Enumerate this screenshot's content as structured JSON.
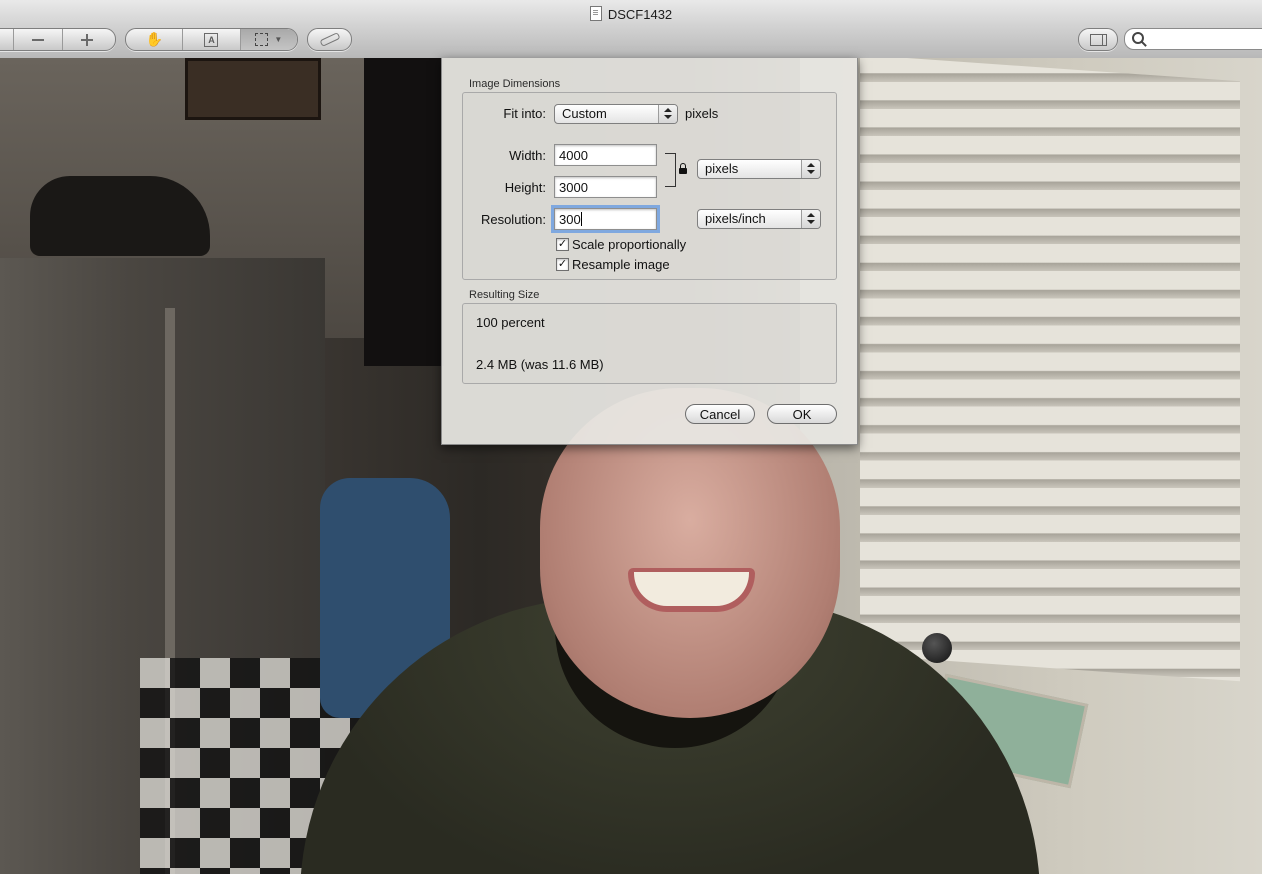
{
  "window": {
    "title": "DSCF1432",
    "icons": {
      "doc": "document-icon",
      "zoom_out": "zoom-out-icon",
      "zoom_in": "zoom-in-icon",
      "hand": "hand-tool-icon",
      "text": "text-select-icon",
      "select": "rect-select-icon",
      "annotate": "annotate-icon",
      "sidebar": "sidebar-icon",
      "search": "search-icon"
    }
  },
  "dialog": {
    "image_dimensions_label": "Image Dimensions",
    "fit_into_label": "Fit into:",
    "fit_into_value": "Custom",
    "fit_into_unit": "pixels",
    "width_label": "Width:",
    "width_value": "4000",
    "height_label": "Height:",
    "height_value": "3000",
    "size_unit_value": "pixels",
    "resolution_label": "Resolution:",
    "resolution_value": "300",
    "resolution_unit_value": "pixels/inch",
    "scale_label": "Scale proportionally",
    "scale_checked": true,
    "resample_label": "Resample image",
    "resample_checked": true,
    "resulting_size_label": "Resulting Size",
    "result_percent": "100 percent",
    "result_size": "2.4 MB (was 11.6 MB)",
    "cancel_label": "Cancel",
    "ok_label": "OK"
  }
}
